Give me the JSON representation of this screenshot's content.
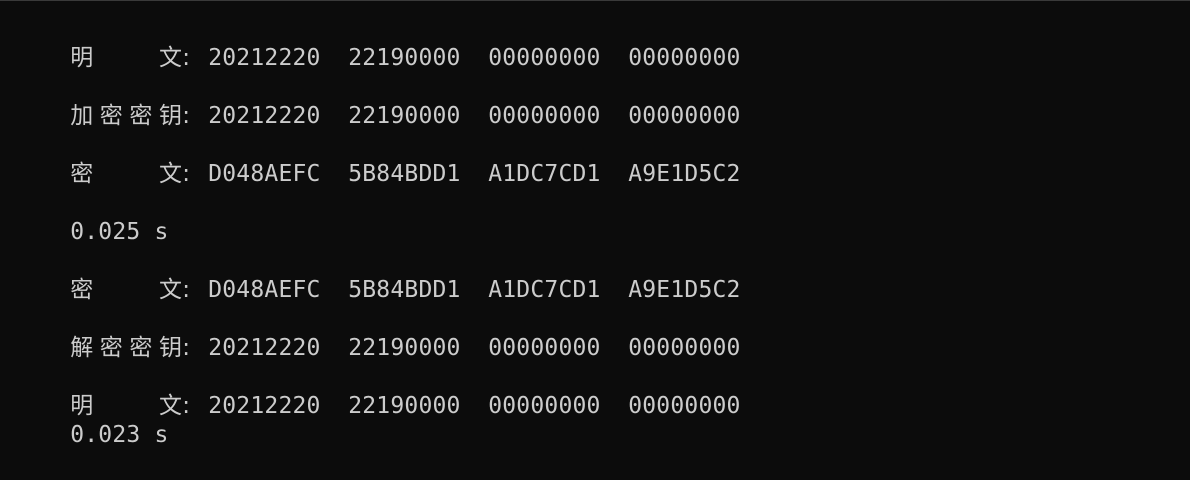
{
  "console": {
    "lines": [
      {
        "label": "明 文",
        "colon": ":",
        "words": [
          "20212220",
          "22190000",
          "00000000",
          "00000000"
        ]
      },
      {
        "label": "加密密钥",
        "colon": ":",
        "words": [
          "20212220",
          "22190000",
          "00000000",
          "00000000"
        ]
      },
      {
        "label": "密 文",
        "colon": ":",
        "words": [
          "D048AEFC",
          "5B84BDD1",
          "A1DC7CD1",
          "A9E1D5C2"
        ]
      },
      {
        "text": "0.025 s"
      },
      {
        "label": "密 文",
        "colon": ":",
        "words": [
          "D048AEFC",
          "5B84BDD1",
          "A1DC7CD1",
          "A9E1D5C2"
        ]
      },
      {
        "label": "解密密钥",
        "colon": ":",
        "words": [
          "20212220",
          "22190000",
          "00000000",
          "00000000"
        ]
      },
      {
        "label": "明 文",
        "colon": ":",
        "words": [
          "20212220",
          "22190000",
          "00000000",
          "00000000"
        ]
      },
      {
        "text": "0.023 s"
      }
    ]
  }
}
